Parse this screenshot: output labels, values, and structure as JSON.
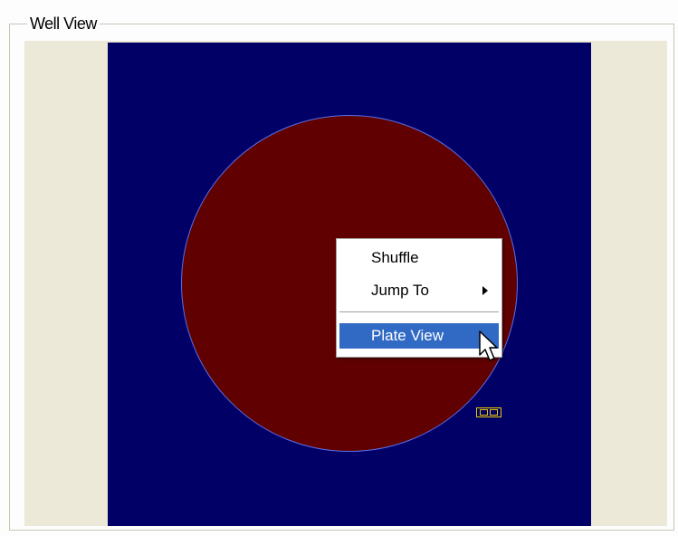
{
  "group": {
    "title": "Well View"
  },
  "context_menu": {
    "items": [
      {
        "label": "Shuffle"
      },
      {
        "label": "Jump To",
        "has_submenu": true
      },
      {
        "label": "Plate View",
        "highlighted": true
      }
    ]
  },
  "colors": {
    "canvas_background": "#000066",
    "well_fill": "#600000",
    "well_outline": "#5a6fe8",
    "marker": "#e8c800",
    "menu_highlight": "#316ac5"
  },
  "icons": {
    "cursor": "arrow-cursor-icon",
    "submenu": "submenu-arrow-icon"
  }
}
